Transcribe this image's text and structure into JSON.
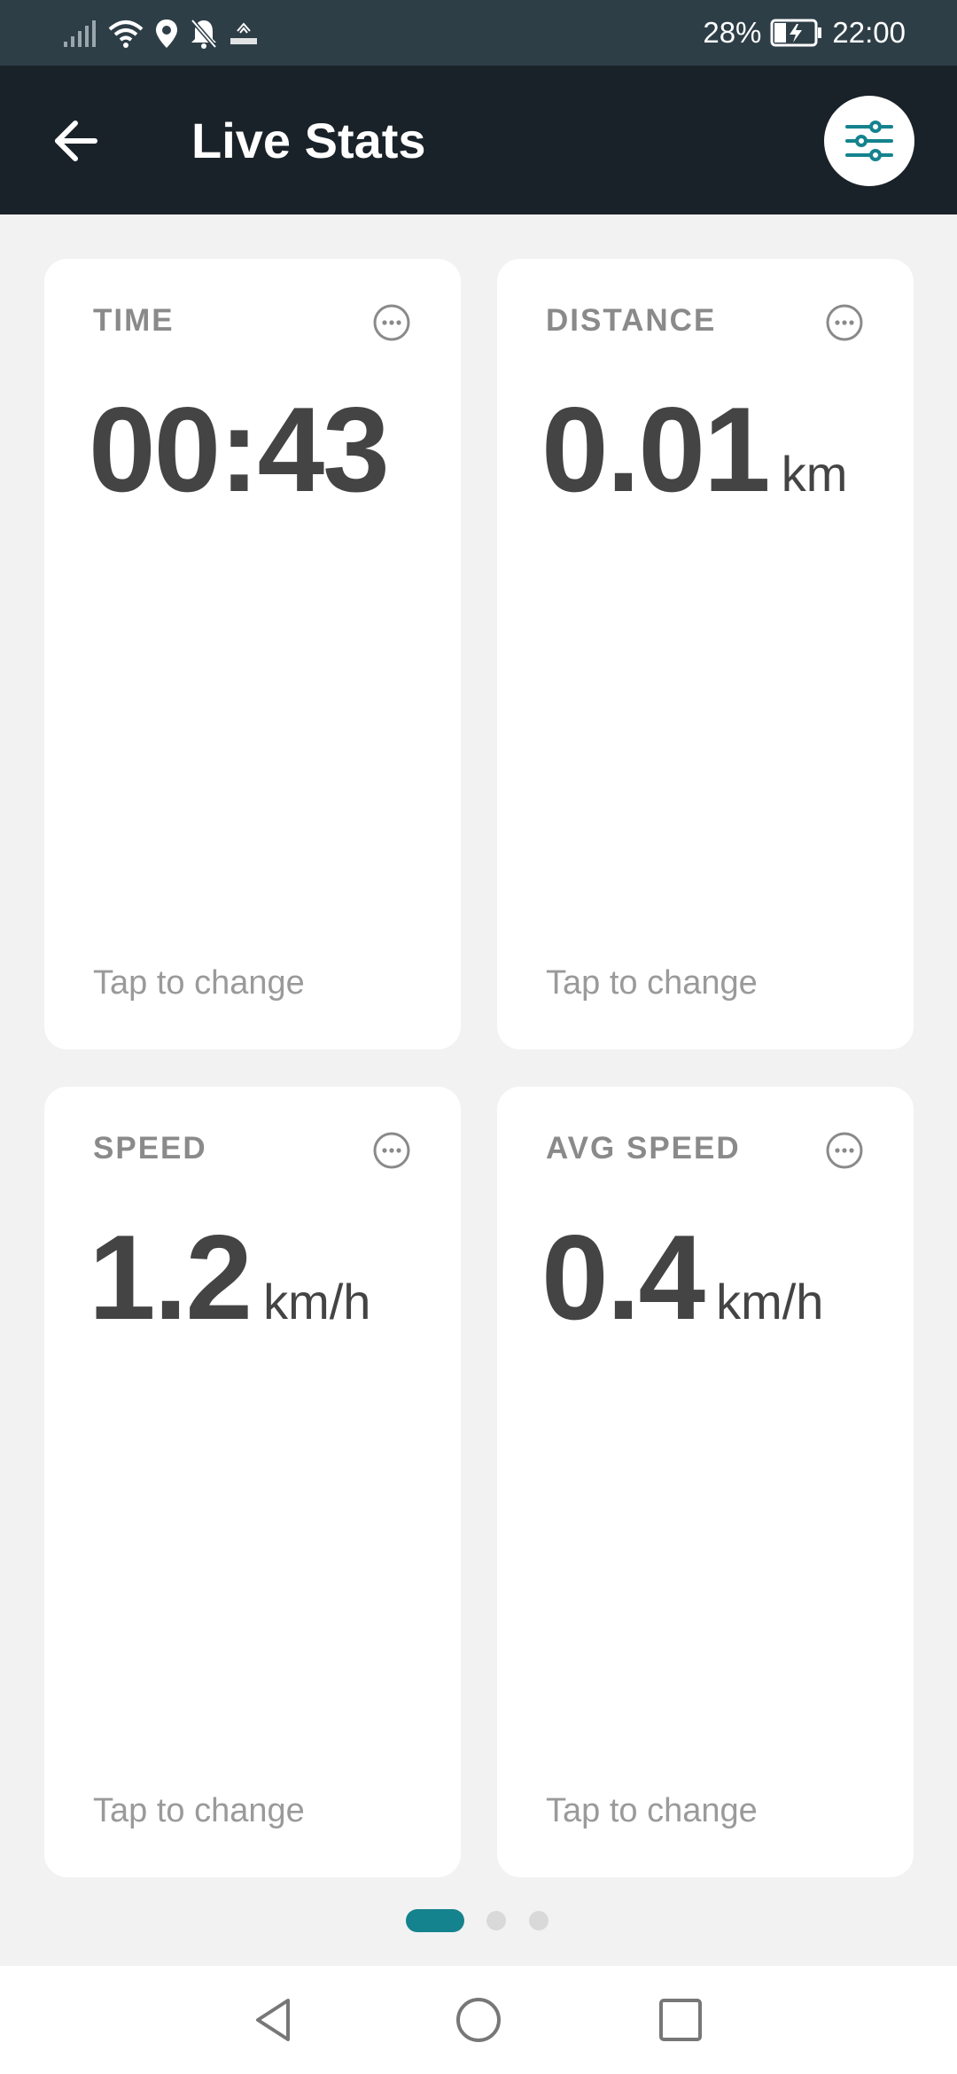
{
  "status_bar": {
    "battery_percent": "28%",
    "time": "22:00",
    "icons": [
      "signal-icon",
      "wifi-icon",
      "location-icon",
      "bell-off-icon",
      "grid90-icon",
      "battery-charging-icon"
    ]
  },
  "header": {
    "title": "Live Stats",
    "back_icon": "arrow-left-icon",
    "filter_icon": "sliders-icon"
  },
  "cards": [
    {
      "label": "TIME",
      "value": "00:43",
      "unit": "",
      "hint": "Tap to change"
    },
    {
      "label": "DISTANCE",
      "value": "0.01",
      "unit": "km",
      "hint": "Tap to change"
    },
    {
      "label": "SPEED",
      "value": "1.2",
      "unit": "km/h",
      "hint": "Tap to change"
    },
    {
      "label": "AVG SPEED",
      "value": "0.4",
      "unit": "km/h",
      "hint": "Tap to change"
    }
  ],
  "pager": {
    "page_count": 3,
    "active_index": 0
  },
  "colors": {
    "accent": "#15838e",
    "header_bg": "#1a2229",
    "status_bg": "#2e3e47",
    "value_text": "#444444",
    "label_text": "#8a8a8a"
  },
  "nav_bar": {
    "icons": [
      "back-triangle-icon",
      "home-circle-icon",
      "recents-square-icon"
    ]
  }
}
